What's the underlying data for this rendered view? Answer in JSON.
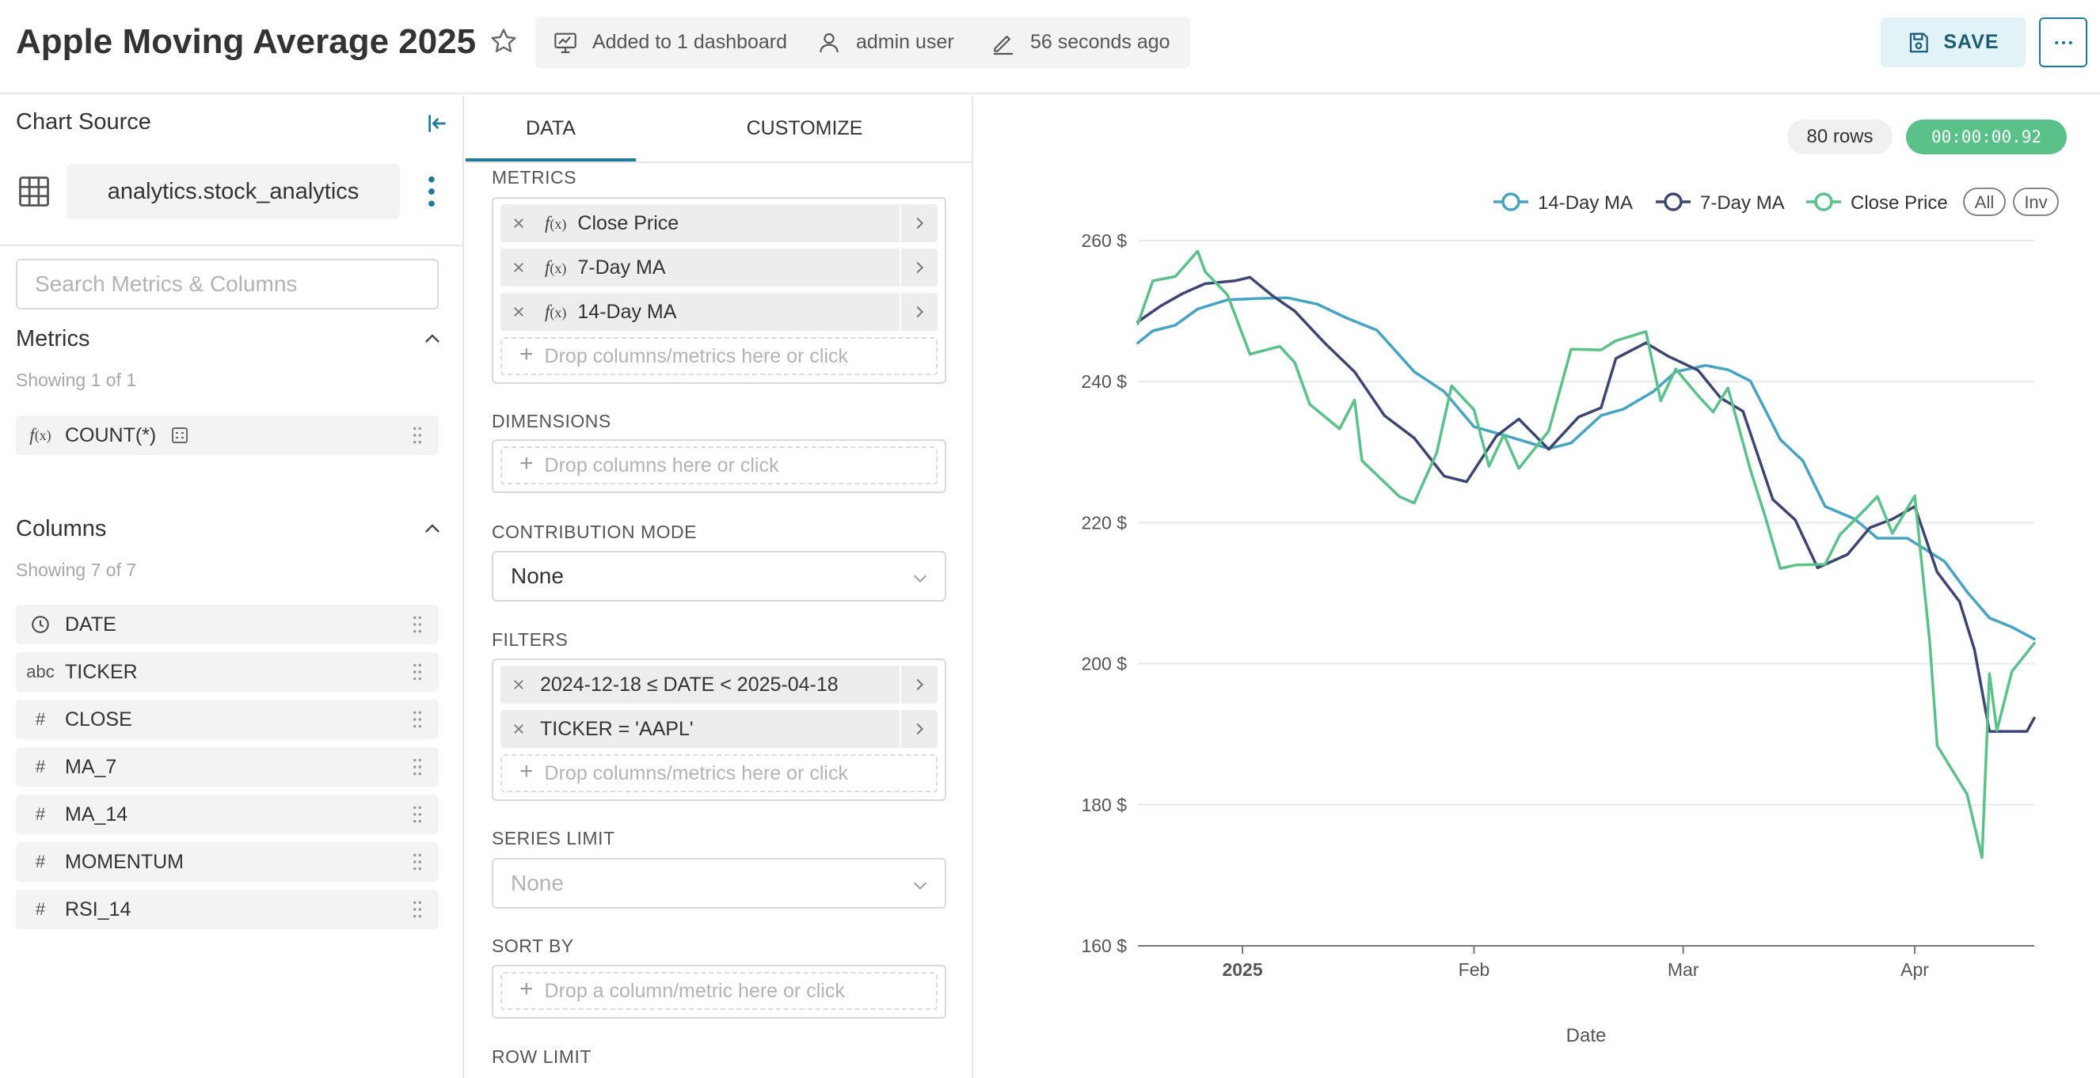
{
  "header": {
    "title": "Apple Moving Average 2025",
    "dashboards": "Added to 1 dashboard",
    "owner": "admin user",
    "modified": "56 seconds ago",
    "save_label": "SAVE",
    "icons": [
      "star-icon",
      "dashboard-icon",
      "user-icon",
      "pencil-icon",
      "save-icon",
      "more-icon"
    ]
  },
  "source_panel": {
    "heading": "Chart Source",
    "datasource": "analytics.stock_analytics",
    "search_placeholder": "Search Metrics & Columns",
    "metrics": {
      "title": "Metrics",
      "count": "Showing 1 of 1",
      "items": [
        {
          "type": "f(x)",
          "label": "COUNT(*)"
        }
      ]
    },
    "columns": {
      "title": "Columns",
      "count": "Showing 7 of 7",
      "items": [
        {
          "type": "clock-icon",
          "label": "DATE"
        },
        {
          "type": "abc",
          "label": "TICKER"
        },
        {
          "type": "#",
          "label": "CLOSE"
        },
        {
          "type": "#",
          "label": "MA_7"
        },
        {
          "type": "#",
          "label": "MA_14"
        },
        {
          "type": "#",
          "label": "MOMENTUM"
        },
        {
          "type": "#",
          "label": "RSI_14"
        }
      ]
    }
  },
  "config_panel": {
    "tabs": [
      "DATA",
      "CUSTOMIZE"
    ],
    "active_tab": "DATA",
    "metrics_label": "METRICS",
    "metrics": [
      "Close Price",
      "7-Day MA",
      "14-Day MA"
    ],
    "metrics_drop": "Drop columns/metrics here or click",
    "dimensions_label": "DIMENSIONS",
    "dimensions_drop": "Drop columns here or click",
    "contribution_label": "CONTRIBUTION MODE",
    "contribution_value": "None",
    "filters_label": "FILTERS",
    "filters": [
      "2024-12-18 ≤ DATE < 2025-04-18",
      "TICKER = 'AAPL'"
    ],
    "filters_drop": "Drop columns/metrics here or click",
    "series_limit_label": "SERIES LIMIT",
    "series_limit_placeholder": "None",
    "sort_by_label": "SORT BY",
    "sort_by_drop": "Drop a column/metric here or click",
    "row_limit_label": "ROW LIMIT"
  },
  "results": {
    "rows": "80 rows",
    "timer": "00:00:00.92"
  },
  "chart_data": {
    "type": "line",
    "xlabel": "Date",
    "ylabel": "",
    "x_domain": [
      "2024-12-18",
      "2025-04-17"
    ],
    "ylim": [
      160,
      265
    ],
    "y_ticks": [
      160,
      180,
      200,
      220,
      240,
      260
    ],
    "y_tick_labels": [
      "160 $",
      "180 $",
      "200 $",
      "220 $",
      "240 $",
      "260 $"
    ],
    "x_ticks": [
      {
        "date": "2025-01-01",
        "label": "2025",
        "bold": true
      },
      {
        "date": "2025-02-01",
        "label": "Feb",
        "bold": false
      },
      {
        "date": "2025-03-01",
        "label": "Mar",
        "bold": false
      },
      {
        "date": "2025-04-01",
        "label": "Apr",
        "bold": false
      }
    ],
    "legend_position": "top-right",
    "legend_controls": [
      "All",
      "Inv"
    ],
    "grid": "horizontal",
    "series": [
      {
        "name": "14-Day MA",
        "color": "#45a4c4",
        "points": [
          [
            "2024-12-18",
            245.5
          ],
          [
            "2024-12-20",
            247.2
          ],
          [
            "2024-12-23",
            248.0
          ],
          [
            "2024-12-26",
            250.3
          ],
          [
            "2024-12-30",
            251.6
          ],
          [
            "2025-01-03",
            251.8
          ],
          [
            "2025-01-07",
            251.9
          ],
          [
            "2025-01-11",
            251.0
          ],
          [
            "2025-01-15",
            249.0
          ],
          [
            "2025-01-19",
            247.3
          ],
          [
            "2025-01-24",
            241.4
          ],
          [
            "2025-01-28",
            238.6
          ],
          [
            "2025-02-01",
            233.6
          ],
          [
            "2025-02-06",
            232.1
          ],
          [
            "2025-02-11",
            230.5
          ],
          [
            "2025-02-14",
            231.3
          ],
          [
            "2025-02-18",
            235.2
          ],
          [
            "2025-02-21",
            236.1
          ],
          [
            "2025-02-25",
            238.6
          ],
          [
            "2025-02-28",
            241.4
          ],
          [
            "2025-03-04",
            242.3
          ],
          [
            "2025-03-07",
            241.7
          ],
          [
            "2025-03-10",
            240.1
          ],
          [
            "2025-03-14",
            231.8
          ],
          [
            "2025-03-17",
            228.8
          ],
          [
            "2025-03-20",
            222.3
          ],
          [
            "2025-03-24",
            220.5
          ],
          [
            "2025-03-27",
            217.8
          ],
          [
            "2025-03-31",
            217.8
          ],
          [
            "2025-04-02",
            216.5
          ],
          [
            "2025-04-05",
            214.5
          ],
          [
            "2025-04-08",
            210.2
          ],
          [
            "2025-04-11",
            206.5
          ],
          [
            "2025-04-14",
            205.2
          ],
          [
            "2025-04-17",
            203.5
          ]
        ]
      },
      {
        "name": "7-Day MA",
        "color": "#3c4573",
        "points": [
          [
            "2024-12-18",
            248.5
          ],
          [
            "2024-12-21",
            250.7
          ],
          [
            "2024-12-24",
            252.5
          ],
          [
            "2024-12-27",
            253.9
          ],
          [
            "2024-12-31",
            254.3
          ],
          [
            "2025-01-02",
            254.8
          ],
          [
            "2025-01-05",
            252.2
          ],
          [
            "2025-01-08",
            250.0
          ],
          [
            "2025-01-12",
            245.5
          ],
          [
            "2025-01-16",
            241.4
          ],
          [
            "2025-01-20",
            235.2
          ],
          [
            "2025-01-24",
            232.0
          ],
          [
            "2025-01-28",
            226.6
          ],
          [
            "2025-01-31",
            225.8
          ],
          [
            "2025-02-04",
            232.3
          ],
          [
            "2025-02-07",
            234.7
          ],
          [
            "2025-02-11",
            230.4
          ],
          [
            "2025-02-15",
            235.0
          ],
          [
            "2025-02-18",
            236.3
          ],
          [
            "2025-02-20",
            243.3
          ],
          [
            "2025-02-24",
            245.5
          ],
          [
            "2025-02-27",
            243.6
          ],
          [
            "2025-03-03",
            241.6
          ],
          [
            "2025-03-06",
            237.7
          ],
          [
            "2025-03-09",
            235.8
          ],
          [
            "2025-03-13",
            223.3
          ],
          [
            "2025-03-16",
            220.4
          ],
          [
            "2025-03-19",
            213.6
          ],
          [
            "2025-03-23",
            215.5
          ],
          [
            "2025-03-26",
            219.3
          ],
          [
            "2025-03-29",
            220.5
          ],
          [
            "2025-04-01",
            222.3
          ],
          [
            "2025-04-04",
            213.0
          ],
          [
            "2025-04-07",
            208.8
          ],
          [
            "2025-04-09",
            202.0
          ],
          [
            "2025-04-11",
            190.4
          ],
          [
            "2025-04-14",
            190.4
          ],
          [
            "2025-04-16",
            190.4
          ],
          [
            "2025-04-17",
            192.3
          ]
        ]
      },
      {
        "name": "Close Price",
        "color": "#5ac189",
        "points": [
          [
            "2024-12-18",
            248.2
          ],
          [
            "2024-12-20",
            254.3
          ],
          [
            "2024-12-23",
            254.9
          ],
          [
            "2024-12-26",
            258.5
          ],
          [
            "2024-12-27",
            255.6
          ],
          [
            "2024-12-30",
            252.3
          ],
          [
            "2025-01-02",
            243.9
          ],
          [
            "2025-01-06",
            245.0
          ],
          [
            "2025-01-08",
            242.7
          ],
          [
            "2025-01-10",
            236.8
          ],
          [
            "2025-01-14",
            233.3
          ],
          [
            "2025-01-16",
            237.4
          ],
          [
            "2025-01-17",
            228.8
          ],
          [
            "2025-01-22",
            223.7
          ],
          [
            "2025-01-24",
            222.8
          ],
          [
            "2025-01-27",
            229.9
          ],
          [
            "2025-01-29",
            239.4
          ],
          [
            "2025-02-01",
            236.0
          ],
          [
            "2025-02-03",
            228.0
          ],
          [
            "2025-02-05",
            232.5
          ],
          [
            "2025-02-07",
            227.7
          ],
          [
            "2025-02-11",
            233.0
          ],
          [
            "2025-02-14",
            244.6
          ],
          [
            "2025-02-18",
            244.5
          ],
          [
            "2025-02-20",
            245.8
          ],
          [
            "2025-02-24",
            247.1
          ],
          [
            "2025-02-26",
            237.3
          ],
          [
            "2025-02-28",
            241.8
          ],
          [
            "2025-03-03",
            238.0
          ],
          [
            "2025-03-05",
            235.7
          ],
          [
            "2025-03-07",
            239.1
          ],
          [
            "2025-03-10",
            227.5
          ],
          [
            "2025-03-12",
            220.8
          ],
          [
            "2025-03-14",
            213.5
          ],
          [
            "2025-03-16",
            214.0
          ],
          [
            "2025-03-20",
            214.1
          ],
          [
            "2025-03-22",
            218.3
          ],
          [
            "2025-03-25",
            221.5
          ],
          [
            "2025-03-27",
            223.7
          ],
          [
            "2025-03-29",
            218.5
          ],
          [
            "2025-04-01",
            223.8
          ],
          [
            "2025-04-03",
            203.2
          ],
          [
            "2025-04-04",
            188.4
          ],
          [
            "2025-04-08",
            181.5
          ],
          [
            "2025-04-10",
            172.5
          ],
          [
            "2025-04-11",
            198.6
          ],
          [
            "2025-04-12",
            190.5
          ],
          [
            "2025-04-14",
            198.9
          ],
          [
            "2025-04-17",
            202.9
          ]
        ]
      }
    ]
  }
}
